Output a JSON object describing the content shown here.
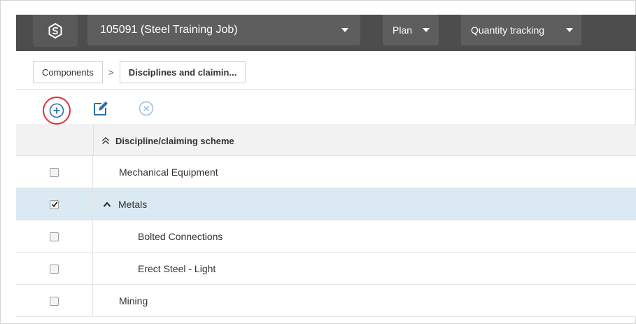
{
  "topbar": {
    "job_name": "105091 (Steel Training Job)",
    "plan_label": "Plan",
    "quantity_label": "Quantity tracking"
  },
  "breadcrumb": {
    "items": [
      "Components",
      "Disciplines and claimin..."
    ],
    "separator": ">"
  },
  "toolbar": {
    "add": "add-icon",
    "edit": "edit-icon",
    "delete": "delete-icon",
    "accent": "#2a6fb0",
    "highlight": "#e0303a"
  },
  "table": {
    "header": "Discipline/claiming scheme",
    "rows": [
      {
        "label": "Mechanical Equipment",
        "checked": false
      },
      {
        "label": "Metals",
        "checked": true
      },
      {
        "label": "Bolted Connections",
        "checked": false
      },
      {
        "label": "Erect Steel - Light",
        "checked": false
      },
      {
        "label": "Mining",
        "checked": false
      }
    ]
  }
}
